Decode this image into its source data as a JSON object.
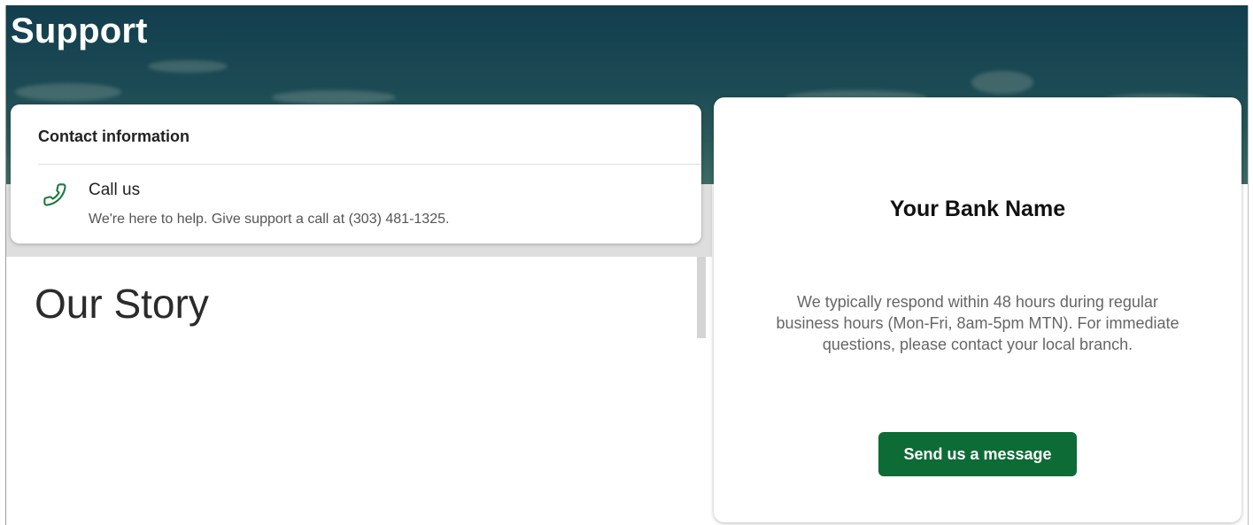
{
  "header": {
    "title": "Support"
  },
  "contact": {
    "title": "Contact information",
    "call": {
      "icon": "phone-icon",
      "title": "Call us",
      "description": "We're here to help. Give support a call at (303) 481-1325."
    }
  },
  "story": {
    "title": "Our Story"
  },
  "bank": {
    "name": "Your Bank Name",
    "description": "We typically respond within 48 hours during regular business hours (Mon-Fri, 8am-5pm MTN). For immediate questions, please contact your local branch.",
    "button_label": "Send us a message"
  },
  "colors": {
    "brand_green": "#0d6b35",
    "hero_teal": "#123e4e"
  }
}
